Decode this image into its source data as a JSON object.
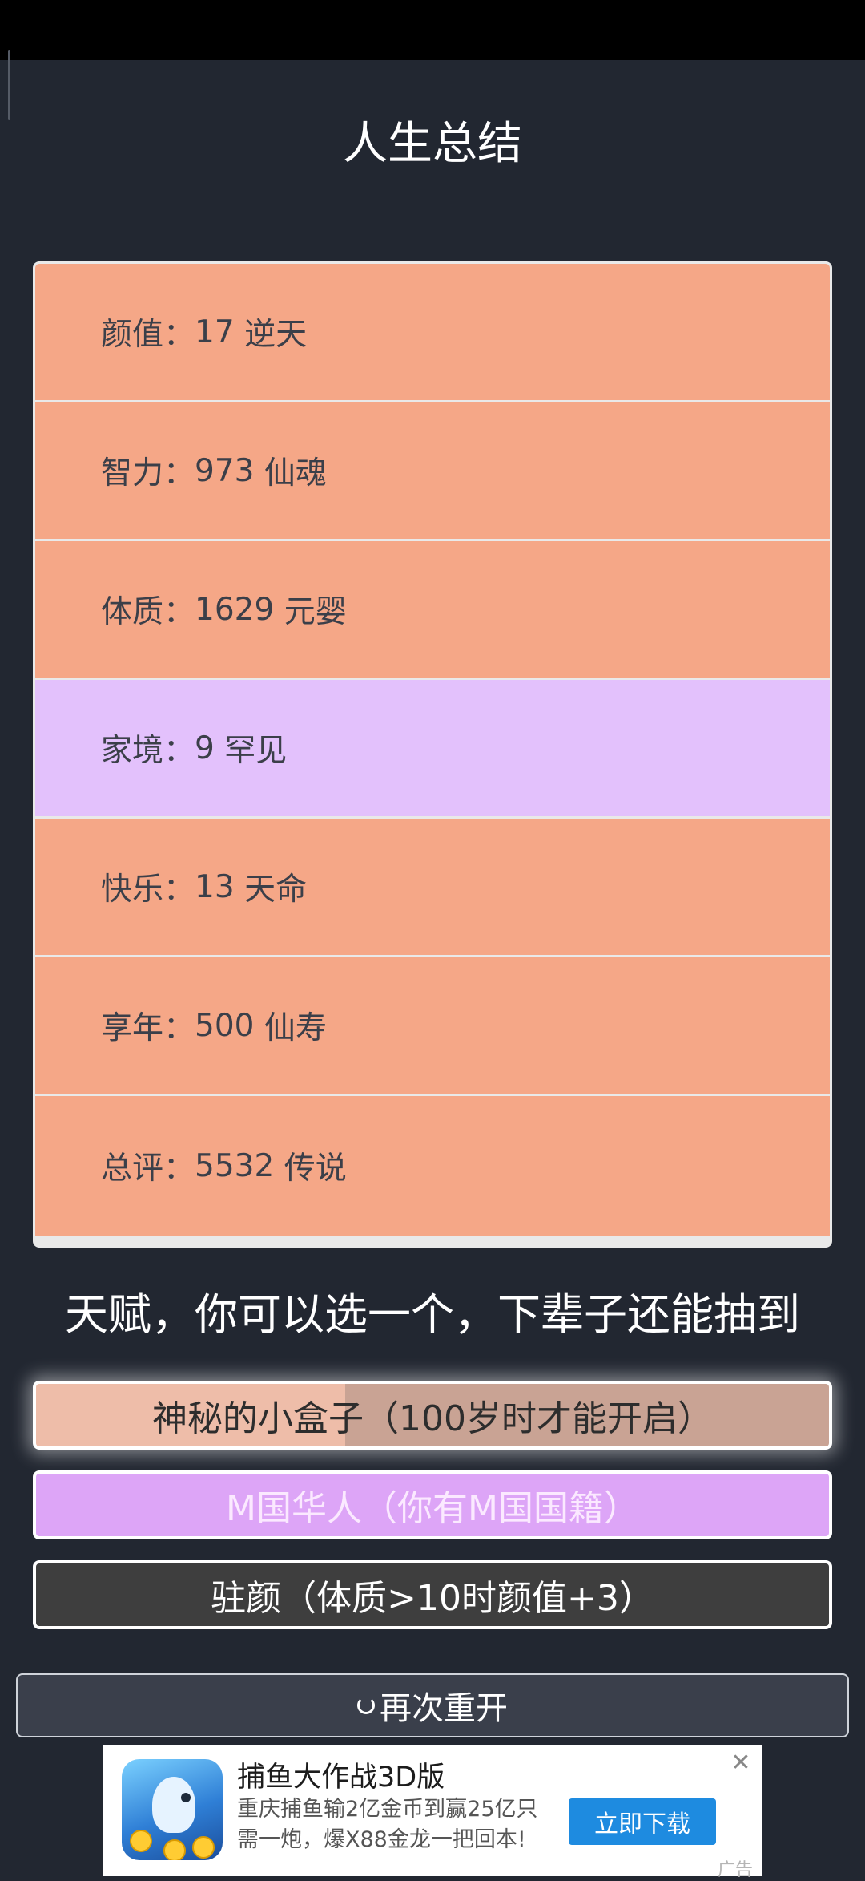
{
  "page": {
    "title": "人生总结"
  },
  "stats": [
    {
      "label": "颜值",
      "value": "17",
      "grade": "逆天",
      "color": "orange"
    },
    {
      "label": "智力",
      "value": "973",
      "grade": "仙魂",
      "color": "orange"
    },
    {
      "label": "体质",
      "value": "1629",
      "grade": "元婴",
      "color": "orange"
    },
    {
      "label": "家境",
      "value": "9",
      "grade": "罕见",
      "color": "purple"
    },
    {
      "label": "快乐",
      "value": "13",
      "grade": "天命",
      "color": "orange"
    },
    {
      "label": "享年",
      "value": "500",
      "grade": "仙寿",
      "color": "orange"
    },
    {
      "label": "总评",
      "value": "5532",
      "grade": "传说",
      "color": "orange"
    }
  ],
  "separator": "：",
  "talents": {
    "heading": "天赋，你可以选一个，下辈子还能抽到",
    "items": [
      {
        "text": "神秘的小盒子（100岁时才能开启）"
      },
      {
        "text": "M国华人（你有M国国籍）"
      },
      {
        "text": "驻颜（体质>10时颜值+3）"
      }
    ]
  },
  "restart": {
    "label": "再次重开"
  },
  "ad": {
    "title": "捕鱼大作战3D版",
    "desc_line1": "重庆捕鱼输2亿金币到赢25亿只",
    "desc_line2": "需一炮，爆X88金龙一把回本!",
    "button": "立即下载",
    "close": "✕",
    "label": "广告"
  },
  "colors": {
    "background": "#222731",
    "orange": "#f5a787",
    "purple": "#e3c1fc",
    "download": "#1e8be0"
  }
}
